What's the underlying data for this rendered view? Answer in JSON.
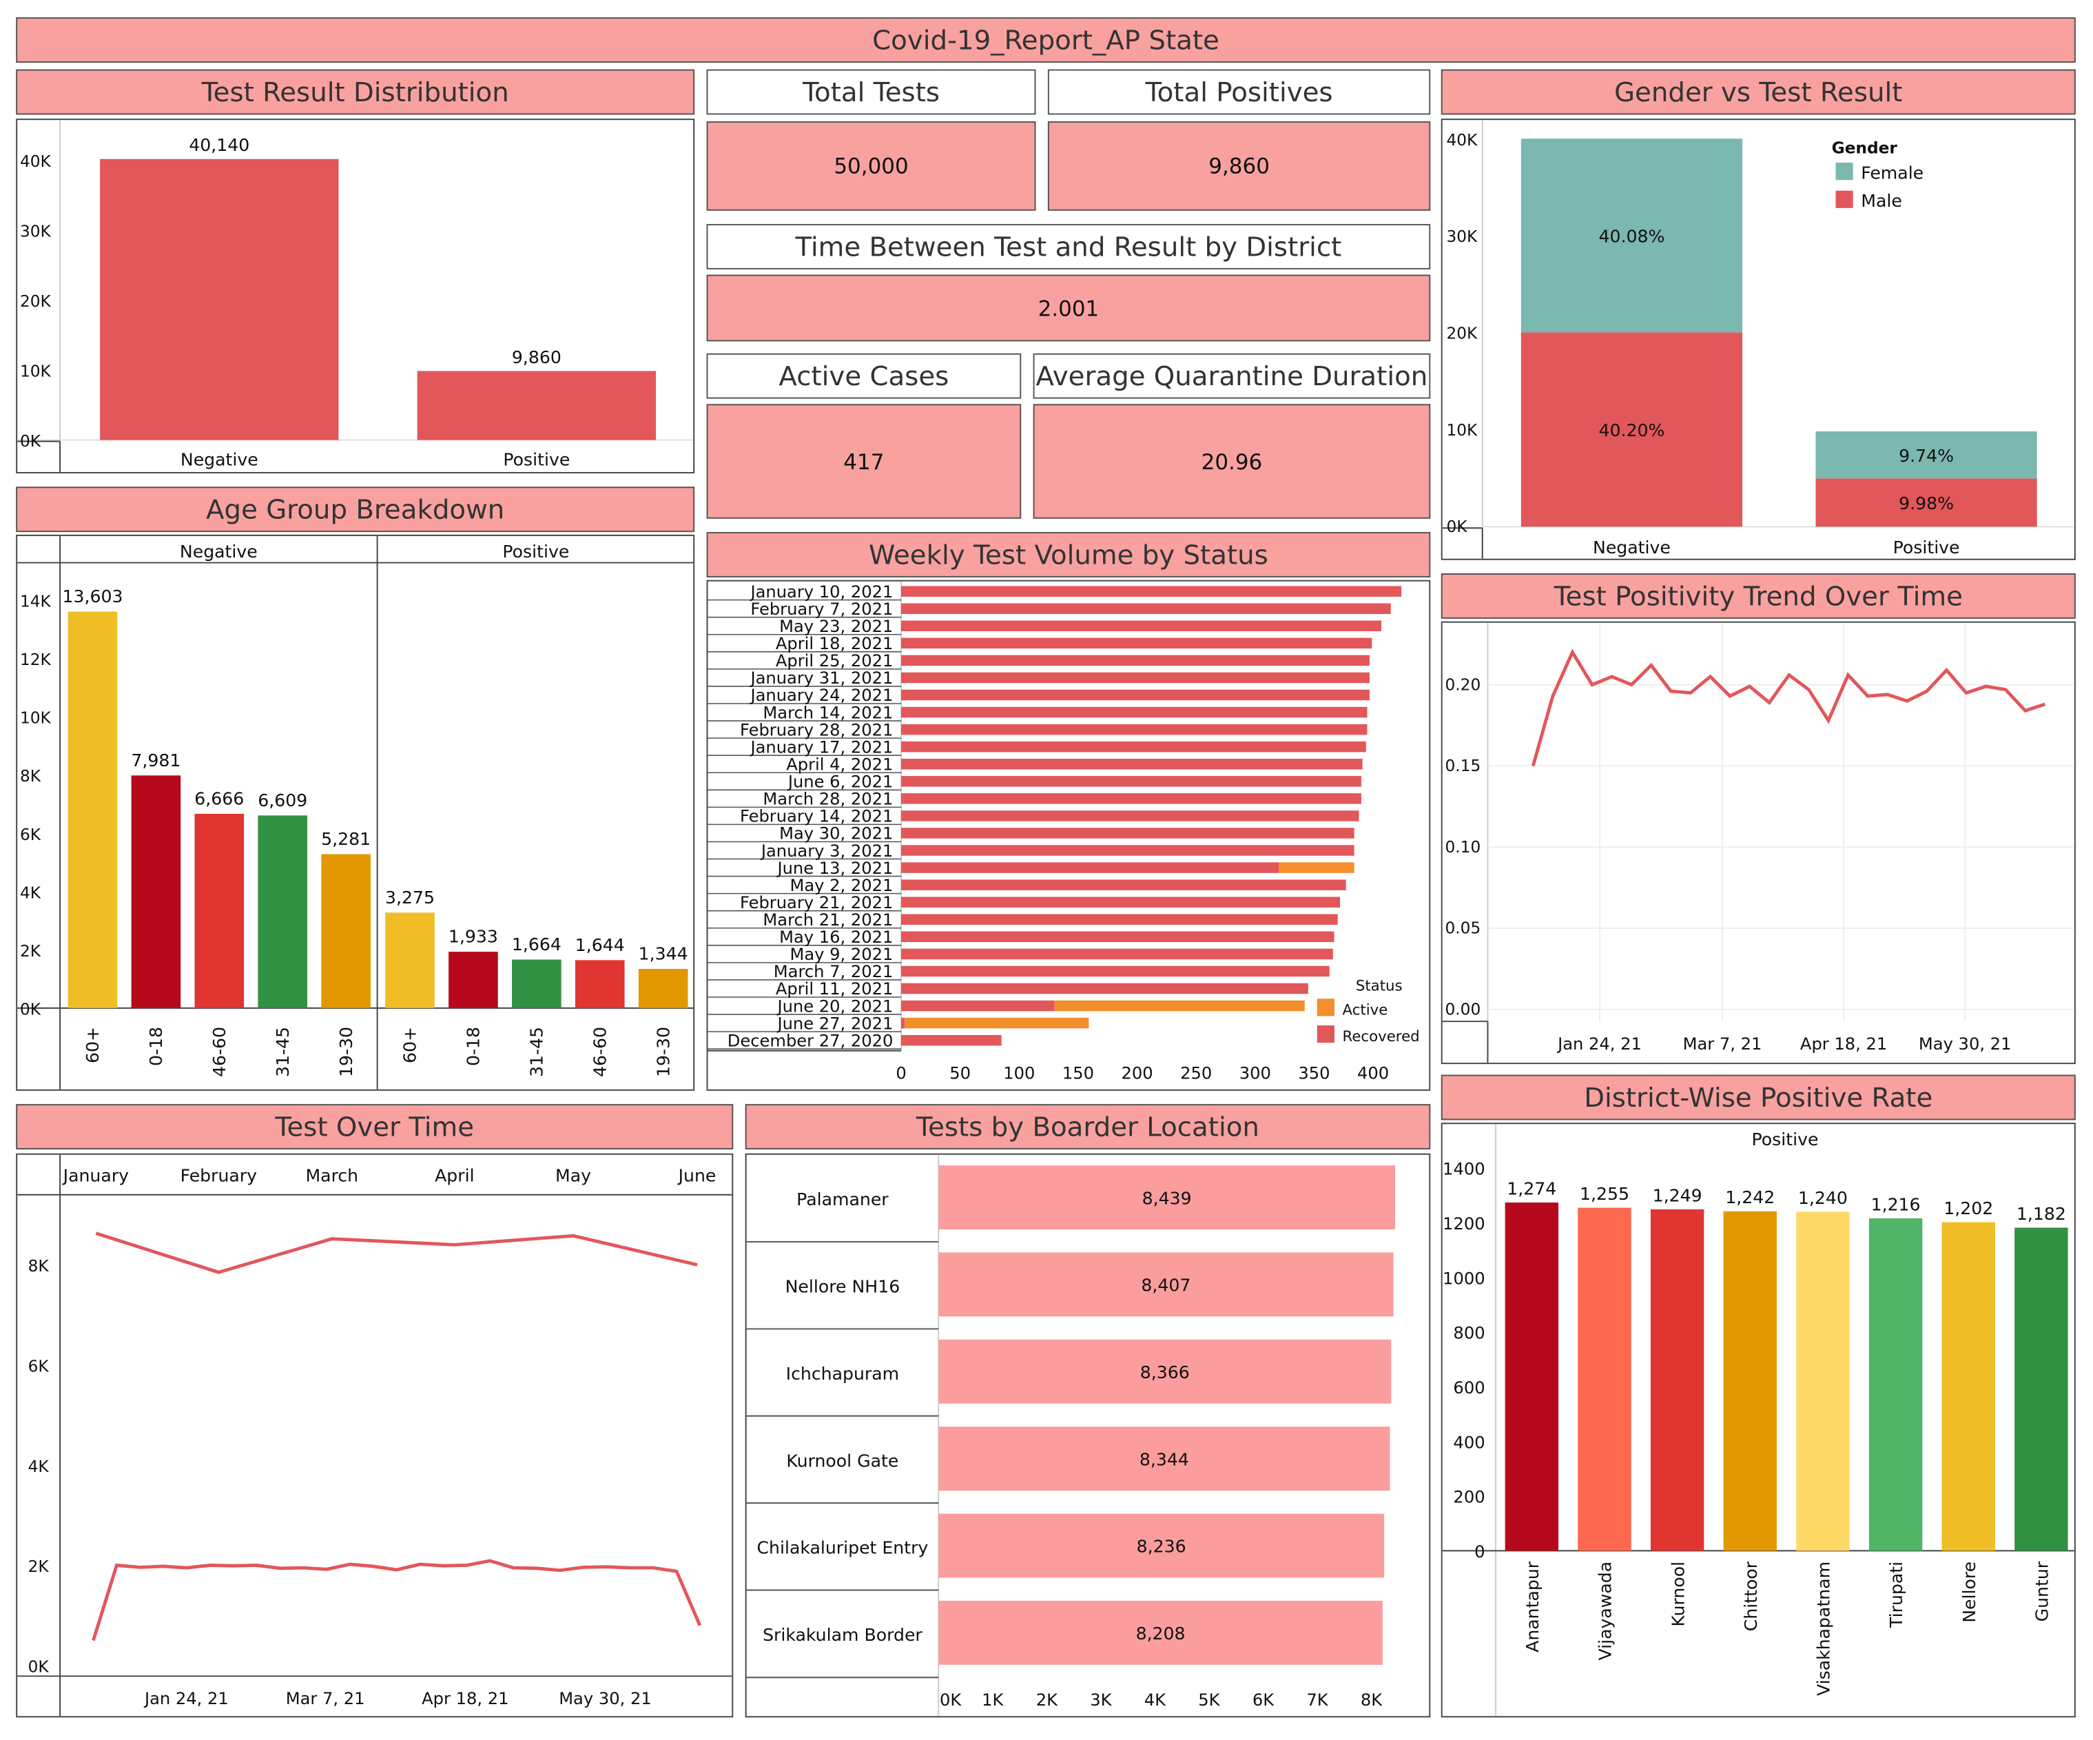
{
  "title": "Covid-19_Report_AP State",
  "kpis": {
    "total_tests_label": "Total Tests",
    "total_tests_value": "50,000",
    "total_positives_label": "Total Positives",
    "total_positives_value": "9,860",
    "time_label": "Time Between Test and Result by District",
    "time_value": "2.001",
    "active_label": "Active Cases",
    "active_value": "417",
    "quarantine_label": "Average Quarantine Duration",
    "quarantine_value": "20.96"
  },
  "panels": {
    "test_result": "Test Result Distribution",
    "age": "Age Group Breakdown",
    "gender": "Gender vs Test Result",
    "weekly": "Weekly Test Volume by Status",
    "positivity": "Test Positivity Trend Over Time",
    "test_over_time": "Test Over Time",
    "border": "Tests by Boarder Location",
    "district": "District-Wise Positive Rate"
  },
  "chart_data": [
    {
      "id": "test_result",
      "type": "bar",
      "categories": [
        "Negative",
        "Positive"
      ],
      "values": [
        40140,
        9860
      ],
      "value_labels": [
        "40,140",
        "9,860"
      ],
      "yticks": [
        "0K",
        "10K",
        "20K",
        "30K",
        "40K"
      ],
      "ylim": [
        0,
        40000
      ],
      "color": "#e2575a"
    },
    {
      "id": "age",
      "type": "bar",
      "panes": [
        {
          "name": "Negative",
          "categories": [
            "60+",
            "0-18",
            "46-60",
            "31-45",
            "19-30"
          ],
          "values": [
            13603,
            7981,
            6666,
            6609,
            5281
          ],
          "value_labels": [
            "13,603",
            "7,981",
            "6,666",
            "6,609",
            "5,281"
          ],
          "colors": [
            "#f0bd27",
            "#b60a1c",
            "#e03531",
            "#309143",
            "#e39802"
          ]
        },
        {
          "name": "Positive",
          "categories": [
            "60+",
            "0-18",
            "31-45",
            "46-60",
            "19-30"
          ],
          "values": [
            3275,
            1933,
            1664,
            1644,
            1344
          ],
          "value_labels": [
            "3,275",
            "1,933",
            "1,664",
            "1,644",
            "1,344"
          ],
          "colors": [
            "#f0bd27",
            "#b60a1c",
            "#309143",
            "#e03531",
            "#e39802"
          ]
        }
      ],
      "yticks": [
        "0K",
        "2K",
        "4K",
        "6K",
        "8K",
        "10K",
        "12K",
        "14K"
      ],
      "ylim": [
        0,
        14000
      ]
    },
    {
      "id": "gender",
      "type": "bar",
      "stacked": true,
      "categories": [
        "Negative",
        "Positive"
      ],
      "series": [
        {
          "name": "Male",
          "values": [
            20100,
            4990
          ],
          "labels": [
            "40.20%",
            "9.98%"
          ],
          "color": "#e2575a"
        },
        {
          "name": "Female",
          "values": [
            20040,
            4870
          ],
          "labels": [
            "40.08%",
            "9.74%"
          ],
          "color": "#7ab8b0"
        }
      ],
      "legend_title": "Gender",
      "legend_items": [
        "Female",
        "Male"
      ],
      "yticks": [
        "0K",
        "10K",
        "20K",
        "30K",
        "40K"
      ],
      "ylim": [
        0,
        40000
      ]
    },
    {
      "id": "weekly",
      "type": "bar",
      "orientation": "horizontal",
      "stacked": true,
      "categories": [
        "January 10, 2021",
        "February 7, 2021",
        "May 23, 2021",
        "April 18, 2021",
        "April 25, 2021",
        "January 31, 2021",
        "January 24, 2021",
        "March 14, 2021",
        "February 28, 2021",
        "January 17, 2021",
        "April 4, 2021",
        "June 6, 2021",
        "March 28, 2021",
        "February 14, 2021",
        "May 30, 2021",
        "January 3, 2021",
        "June 13, 2021",
        "May 2, 2021",
        "February 21, 2021",
        "March 21, 2021",
        "May 16, 2021",
        "May 9, 2021",
        "March 7, 2021",
        "April 11, 2021",
        "June 20, 2021",
        "June 27, 2021",
        "December 27, 2020"
      ],
      "series": [
        {
          "name": "Recovered",
          "values": [
            424,
            415,
            407,
            399,
            397,
            397,
            397,
            395,
            395,
            394,
            391,
            390,
            390,
            388,
            384,
            384,
            320,
            377,
            372,
            370,
            367,
            366,
            363,
            345,
            130,
            3,
            85
          ],
          "color": "#e2575a"
        },
        {
          "name": "Active",
          "values": [
            0,
            0,
            0,
            0,
            0,
            0,
            0,
            0,
            0,
            0,
            0,
            0,
            0,
            0,
            0,
            0,
            64,
            0,
            0,
            0,
            0,
            0,
            0,
            0,
            212,
            156,
            0
          ],
          "color": "#f28e2b"
        }
      ],
      "xticks": [
        "0",
        "50",
        "100",
        "150",
        "200",
        "250",
        "300",
        "350",
        "400"
      ],
      "xlim": [
        0,
        430
      ],
      "legend_title": "Status",
      "legend_items": [
        "Active",
        "Recovered"
      ]
    },
    {
      "id": "positivity",
      "type": "line",
      "values": [
        0.15,
        0.193,
        0.22,
        0.2,
        0.205,
        0.2,
        0.212,
        0.196,
        0.195,
        0.205,
        0.193,
        0.199,
        0.189,
        0.206,
        0.197,
        0.178,
        0.206,
        0.193,
        0.194,
        0.19,
        0.196,
        0.209,
        0.195,
        0.199,
        0.197,
        0.184,
        0.188
      ],
      "yticks": [
        "0.00",
        "0.05",
        "0.10",
        "0.15",
        "0.20"
      ],
      "ylim": [
        0,
        0.23
      ],
      "xticks": [
        "Jan 24, 21",
        "Mar 7, 21",
        "Apr 18, 21",
        "May 30, 21"
      ],
      "color": "#e2575a"
    },
    {
      "id": "test_over_time",
      "type": "line",
      "top_axis": [
        "January",
        "February",
        "March",
        "April",
        "May",
        "June"
      ],
      "monthly_values": [
        8630,
        7850,
        8520,
        8400,
        8580,
        8000
      ],
      "weekly_values": [
        500,
        2000,
        1960,
        1980,
        1950,
        2000,
        1990,
        2000,
        1940,
        1950,
        1920,
        2020,
        1980,
        1910,
        2020,
        1990,
        2000,
        2090,
        1950,
        1940,
        1900,
        1960,
        1970,
        1950,
        1950,
        1880,
        800
      ],
      "yticks": [
        "0K",
        "2K",
        "4K",
        "6K",
        "8K"
      ],
      "ylim": [
        0,
        9000
      ],
      "xticks": [
        "Jan 24, 21",
        "Mar 7, 21",
        "Apr 18, 21",
        "May 30, 21"
      ],
      "color": "#e2575a"
    },
    {
      "id": "border",
      "type": "bar",
      "orientation": "horizontal",
      "categories": [
        "Palamaner",
        "Nellore NH16",
        "Ichchapuram",
        "Kurnool Gate",
        "Chilakaluripet Entry",
        "Srikakulam Border"
      ],
      "values": [
        8439,
        8407,
        8366,
        8344,
        8236,
        8208
      ],
      "value_labels": [
        "8,439",
        "8,407",
        "8,366",
        "8,344",
        "8,236",
        "8,208"
      ],
      "xticks": [
        "0K",
        "1K",
        "2K",
        "3K",
        "4K",
        "5K",
        "6K",
        "7K",
        "8K"
      ],
      "xlim": [
        0,
        8500
      ],
      "color": "#fb9d9d"
    },
    {
      "id": "district",
      "type": "bar",
      "header": "Positive",
      "categories": [
        "Anantapur",
        "Vijayawada",
        "Kurnool",
        "Chittoor",
        "Visakhapatnam",
        "Tirupati",
        "Nellore",
        "Guntur"
      ],
      "values": [
        1274,
        1255,
        1249,
        1242,
        1240,
        1216,
        1202,
        1182
      ],
      "value_labels": [
        "1,274",
        "1,255",
        "1,249",
        "1,242",
        "1,240",
        "1,216",
        "1,202",
        "1,182"
      ],
      "colors": [
        "#b60a1c",
        "#fe684e",
        "#e03531",
        "#e39802",
        "#fed966",
        "#4fb466",
        "#f0bd27",
        "#309143"
      ],
      "yticks": [
        "0",
        "200",
        "400",
        "600",
        "800",
        "1000",
        "1200",
        "1400"
      ],
      "ylim": [
        0,
        1400
      ]
    }
  ]
}
